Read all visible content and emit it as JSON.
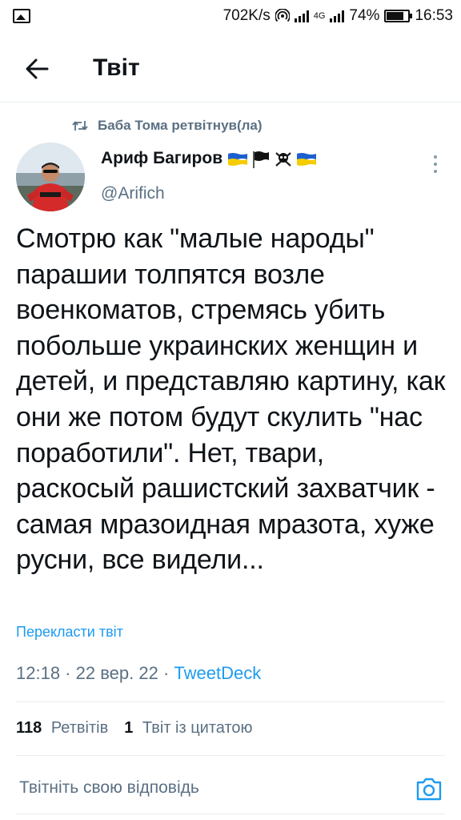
{
  "status_bar": {
    "speed": "702K/s",
    "network": "4G",
    "battery": "74%",
    "time": "16:53"
  },
  "header": {
    "title": "Твіт"
  },
  "retweet_context": {
    "text": "Баба Тома ретвітнув(ла)"
  },
  "tweet": {
    "author_name": "Ариф Багиров",
    "handle": "@Arifich",
    "text": "Смотрю как \"малые народы\" парашии толпятся возле военкоматов, стремясь убить побольше украинских женщин и детей, и представляю картину, как они же потом будут скулить \"нас поработили\". Нет, твари, раскосый рашистский захватчик - самая мразоидная мразота, хуже русни, все видели...",
    "translate_label": "Перекласти твіт",
    "time": "12:18",
    "date": "22 вер. 22",
    "source": "TweetDeck",
    "separator": " · "
  },
  "stats": {
    "retweets_count": "118",
    "retweets_label": "Ретвітів",
    "quotes_count": "1",
    "quotes_label": "Твіт із цитатою"
  },
  "reply": {
    "placeholder": "Твітніть свою відповідь"
  },
  "colors": {
    "accent": "#1d9bf0",
    "secondary_text": "#5b7083",
    "divider": "#e6ecf0"
  }
}
